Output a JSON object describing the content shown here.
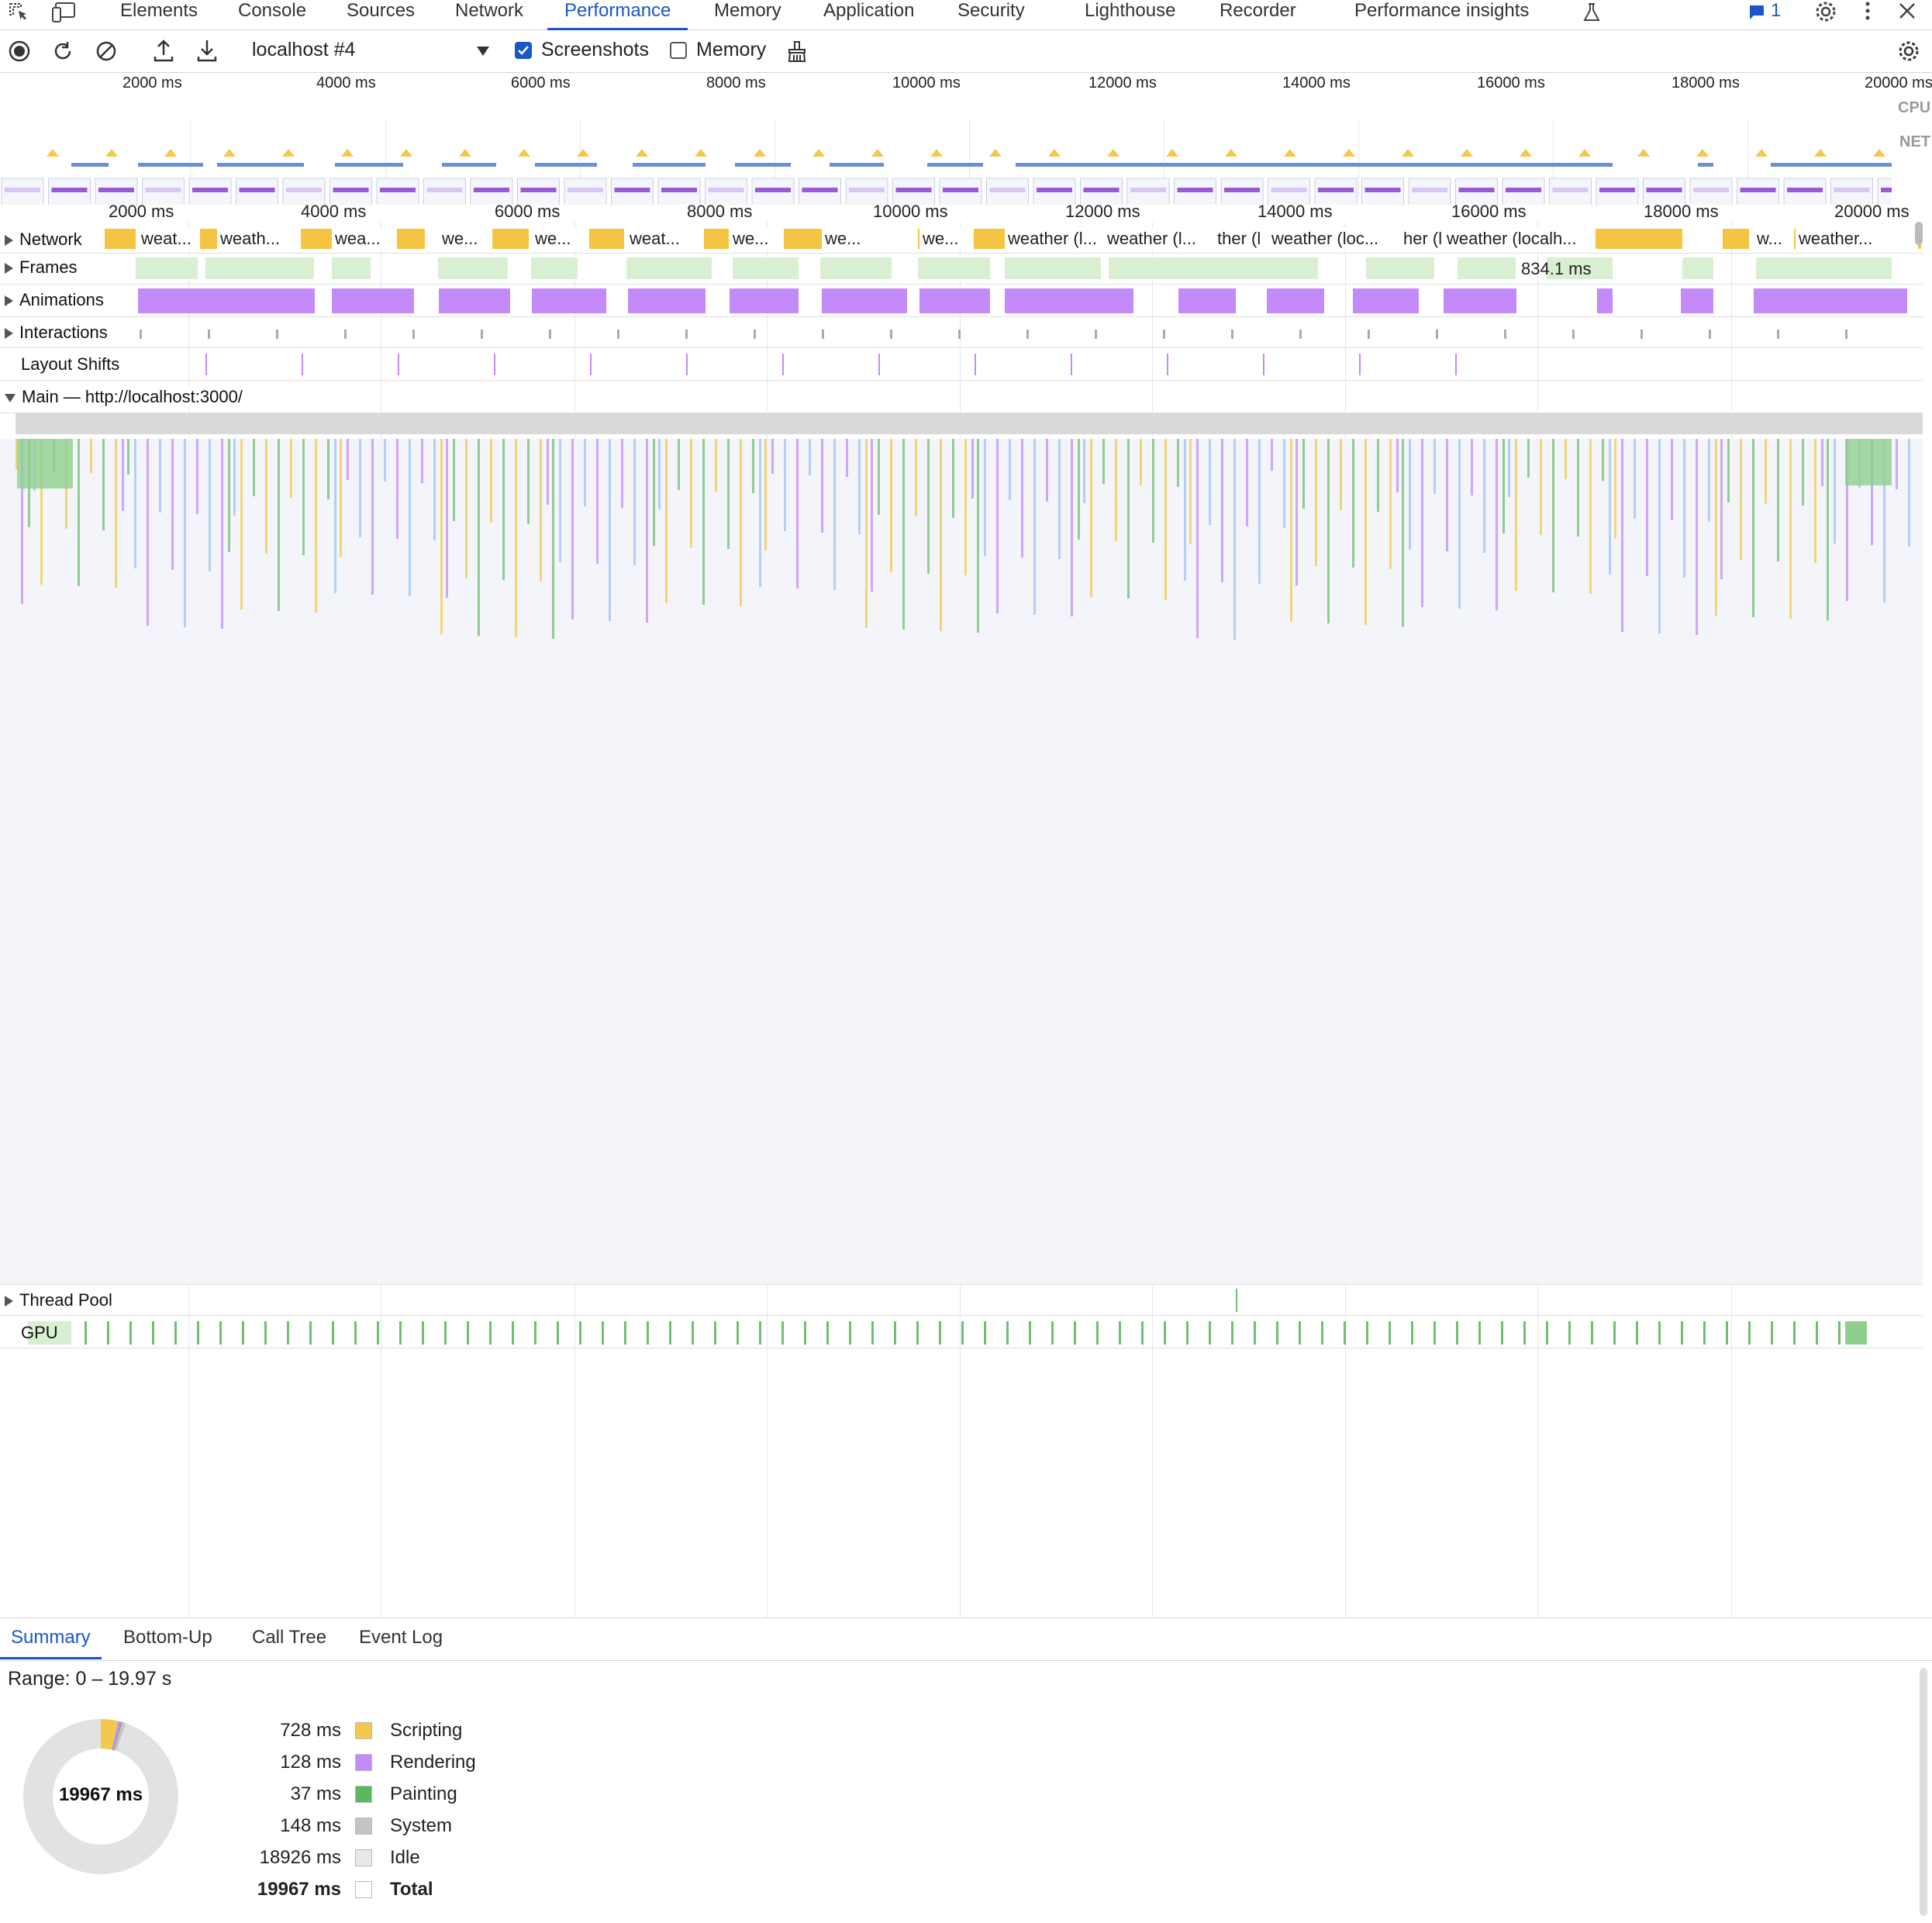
{
  "tabs": {
    "items": [
      "Elements",
      "Console",
      "Sources",
      "Network",
      "Performance",
      "Memory",
      "Application",
      "Security",
      "Lighthouse",
      "Recorder",
      "Performance insights"
    ],
    "active": "Performance",
    "issues_count": "1"
  },
  "toolbar": {
    "profile_select": "localhost #4",
    "screenshots_label": "Screenshots",
    "screenshots_checked": true,
    "memory_label": "Memory",
    "memory_checked": false
  },
  "overview": {
    "ticks": [
      "2000 ms",
      "4000 ms",
      "6000 ms",
      "8000 ms",
      "10000 ms",
      "12000 ms",
      "14000 ms",
      "16000 ms",
      "18000 ms",
      "20000 ms"
    ],
    "cpu_label": "CPU",
    "net_label": "NET"
  },
  "ruler": {
    "ticks": [
      "2000 ms",
      "4000 ms",
      "6000 ms",
      "8000 ms",
      "10000 ms",
      "12000 ms",
      "14000 ms",
      "16000 ms",
      "18000 ms",
      "20000 ms"
    ]
  },
  "tracks": {
    "network": "Network",
    "frames": "Frames",
    "animations": "Animations",
    "interactions": "Interactions",
    "layout_shifts": "Layout Shifts",
    "main": "Main — http://localhost:3000/",
    "thread_pool": "Thread Pool",
    "gpu": "GPU"
  },
  "network_requests": [
    "weat...",
    "weath...",
    "wea...",
    "we...",
    "we...",
    "weat...",
    "we...",
    "we...",
    "we...",
    "weather (l...",
    "weather (l...",
    "ther (l",
    "weather (loc...",
    "her (l",
    "weather (localh...",
    "w...",
    "weather..."
  ],
  "frames_tooltip": "834.1 ms",
  "bottom_tabs": {
    "items": [
      "Summary",
      "Bottom-Up",
      "Call Tree",
      "Event Log"
    ],
    "active": "Summary"
  },
  "summary": {
    "range": "Range: 0 – 19.97 s",
    "total_center": "19967 ms",
    "legend": [
      {
        "value": "728 ms",
        "name": "Scripting",
        "color": "#f2c94c"
      },
      {
        "value": "128 ms",
        "name": "Rendering",
        "color": "#c58af9"
      },
      {
        "value": "37 ms",
        "name": "Painting",
        "color": "#5cb85c"
      },
      {
        "value": "148 ms",
        "name": "System",
        "color": "#c4c4c4"
      },
      {
        "value": "18926 ms",
        "name": "Idle",
        "color": "#e8e8e8"
      },
      {
        "value": "19967 ms",
        "name": "Total",
        "color": "#ffffff"
      }
    ]
  }
}
